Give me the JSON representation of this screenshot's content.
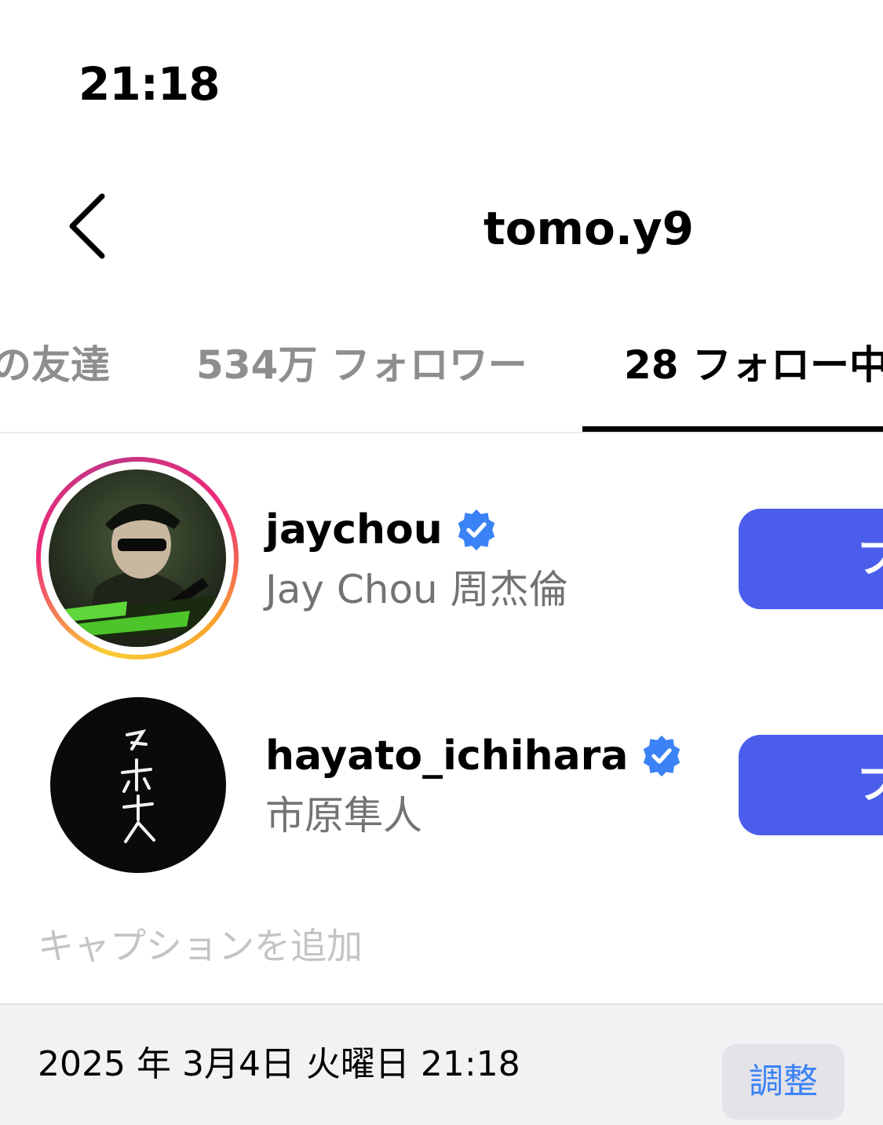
{
  "status_bar": {
    "time": "21:18"
  },
  "header": {
    "title": "tomo.y9",
    "back_icon": "chevron-left-icon"
  },
  "tabs": [
    {
      "label": "の友達",
      "active": false
    },
    {
      "label": "534万 フォロワー",
      "active": false
    },
    {
      "label": "28 フォロー中",
      "active": true
    }
  ],
  "users": [
    {
      "username": "jaychou",
      "full_name": "Jay Chou 周杰倫",
      "verified": true,
      "has_story_ring": true,
      "button_label": "フォロー"
    },
    {
      "username": "hayato_ichihara",
      "full_name": "市原隼人",
      "verified": true,
      "has_story_ring": false,
      "button_label": "フォロー"
    }
  ],
  "caption": {
    "placeholder": "キャプションを追加",
    "value": ""
  },
  "footer": {
    "datetime": "2025 年 3月4日 火曜日 21:18",
    "adjust_label": "調整"
  },
  "colors": {
    "follow_button": "#4a5deb",
    "verified_badge": "#3b82f6",
    "secondary_text": "#737373",
    "adjust_text": "#3b82f6"
  }
}
